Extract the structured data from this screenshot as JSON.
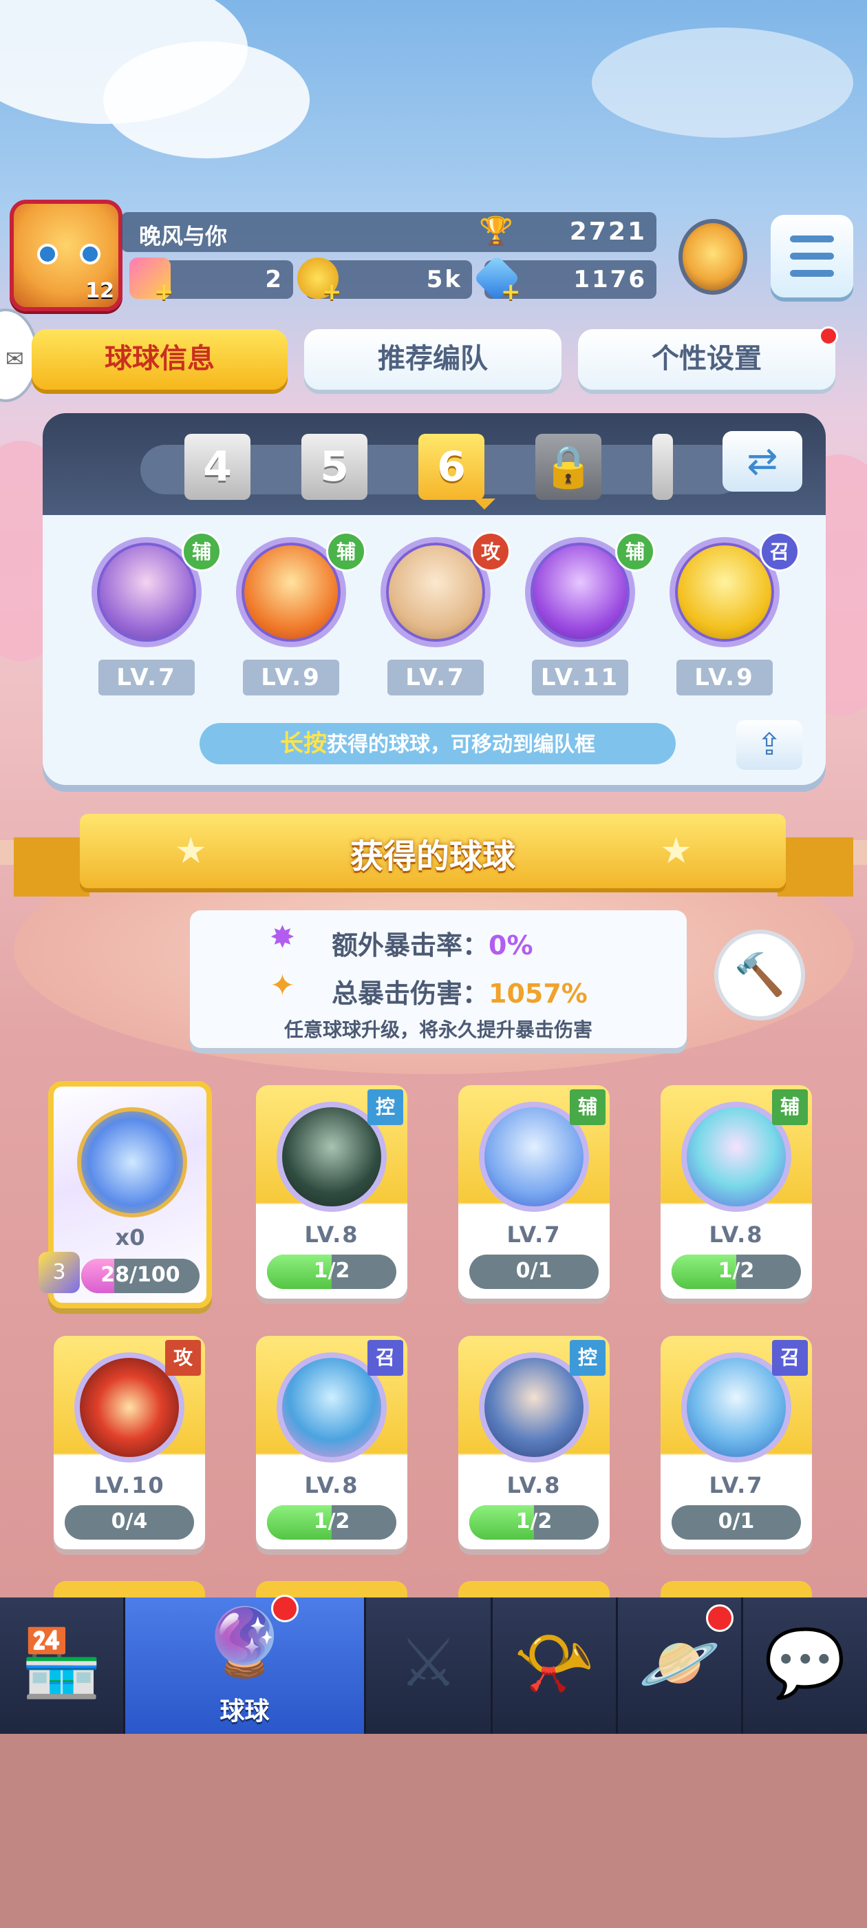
{
  "player": {
    "name": "晚风与你",
    "level": "12",
    "trophies": "2721",
    "ticket": "2",
    "coins": "5k",
    "gems": "1176"
  },
  "tabs": [
    {
      "label": "球球信息",
      "active": true
    },
    {
      "label": "推荐编队",
      "active": false
    },
    {
      "label": "个性设置",
      "active": false,
      "notify": true
    }
  ],
  "team": {
    "slots": [
      "4",
      "5",
      "6",
      "",
      ""
    ],
    "active_slot": "6",
    "balls": [
      {
        "role": "辅",
        "level": "LV.7"
      },
      {
        "role": "辅",
        "level": "LV.9"
      },
      {
        "role": "攻",
        "level": "LV.7"
      },
      {
        "role": "辅",
        "level": "LV.11"
      },
      {
        "role": "召",
        "level": "LV.9"
      }
    ],
    "hint_highlight": "长按",
    "hint_text": "获得的球球，可移动到编队框"
  },
  "obtained": {
    "title": "获得的球球",
    "crit_rate_label": "额外暴击率：",
    "crit_rate_value": "0%",
    "crit_damage_label": "总暴击伤害：",
    "crit_damage_value": "1057%",
    "note": "任意球球升级，将永久提升暴击伤害"
  },
  "special_card": {
    "count": "x0",
    "progress": "28/100",
    "fraction": 0.28,
    "puzzle_level": "3"
  },
  "cards": [
    {
      "tag": "控",
      "level": "LV.8",
      "progress": "1/2",
      "fraction": 0.5
    },
    {
      "tag": "辅",
      "level": "LV.7",
      "progress": "0/1",
      "fraction": 0
    },
    {
      "tag": "辅",
      "level": "LV.8",
      "progress": "1/2",
      "fraction": 0.5
    },
    {
      "tag": "攻",
      "level": "LV.10",
      "progress": "0/4",
      "fraction": 0
    },
    {
      "tag": "召",
      "level": "LV.8",
      "progress": "1/2",
      "fraction": 0.5
    },
    {
      "tag": "控",
      "level": "LV.8",
      "progress": "1/2",
      "fraction": 0.5
    },
    {
      "tag": "召",
      "level": "LV.7",
      "progress": "0/1",
      "fraction": 0
    }
  ],
  "bottom_nav": [
    {
      "icon": "shop-icon",
      "label": ""
    },
    {
      "icon": "ball-icon",
      "label": "球球",
      "active": true,
      "notify": true
    },
    {
      "icon": "crossed-swords-icon",
      "label": ""
    },
    {
      "icon": "whistle-icon",
      "label": ""
    },
    {
      "icon": "planet-icon",
      "label": "",
      "notify": true
    },
    {
      "icon": "chat-icon",
      "label": ""
    }
  ],
  "colors": {
    "tab_active": "#f6b71c",
    "accent_purple": "#b25df0",
    "accent_orange": "#f1a22a",
    "progress_green": "#54c544",
    "nav_active": "#2a57c9"
  }
}
